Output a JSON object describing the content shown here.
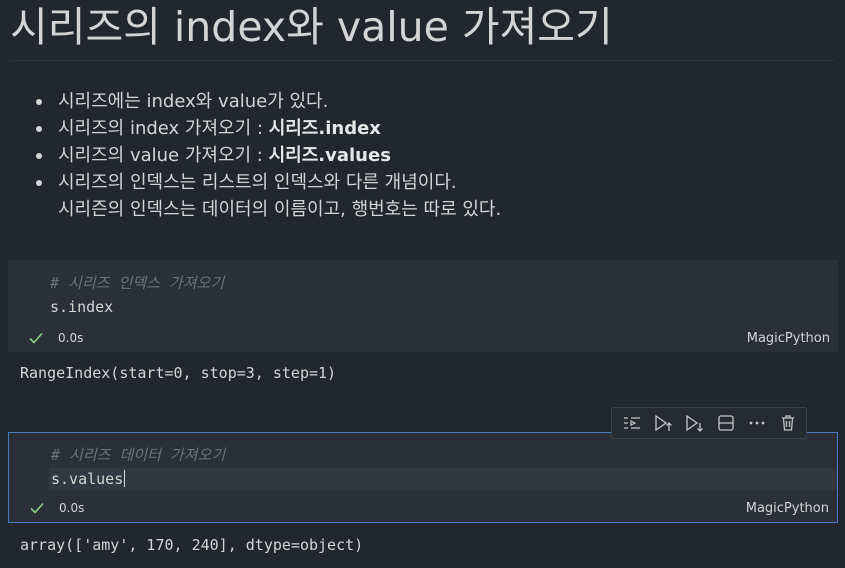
{
  "markdown": {
    "title": "시리즈의 index와 value 가져오기",
    "bullets": [
      {
        "text": "시리즈에는 index와 value가 있다.",
        "bold": ""
      },
      {
        "text": "시리즈의 index 가져오기 : ",
        "bold": "시리즈.index"
      },
      {
        "text": "시리즈의 value 가져오기 : ",
        "bold": "시리즈.values"
      },
      {
        "text": "시리즈의 인덱스는 리스트의 인덱스와 다른 개념이다.",
        "bold": ""
      },
      {
        "text": "시리즌의 인덱스는 데이터의 이름이고, 행번호는 따로 있다.",
        "bold": "",
        "continuation": true
      }
    ]
  },
  "cells": [
    {
      "comment": "# 시리즈 인덱스 가져오기",
      "code": "s.index",
      "time": "0.0s",
      "language": "MagicPython",
      "output": "RangeIndex(start=0, stop=3, step=1)"
    },
    {
      "comment": "# 시리즈 데이터 가져오기",
      "code": "s.values",
      "time": "0.0s",
      "language": "MagicPython",
      "output": "array(['amy', 170, 240], dtype=object)"
    }
  ],
  "toolbar": {
    "buttons": [
      "run-by-line-icon",
      "execute-above-icon",
      "execute-below-icon",
      "split-cell-icon",
      "more-actions-icon",
      "delete-icon"
    ]
  },
  "colors": {
    "background": "#22272e",
    "cell_background": "#2b3038",
    "focus_border": "#4a78c2",
    "success": "#89d185"
  }
}
